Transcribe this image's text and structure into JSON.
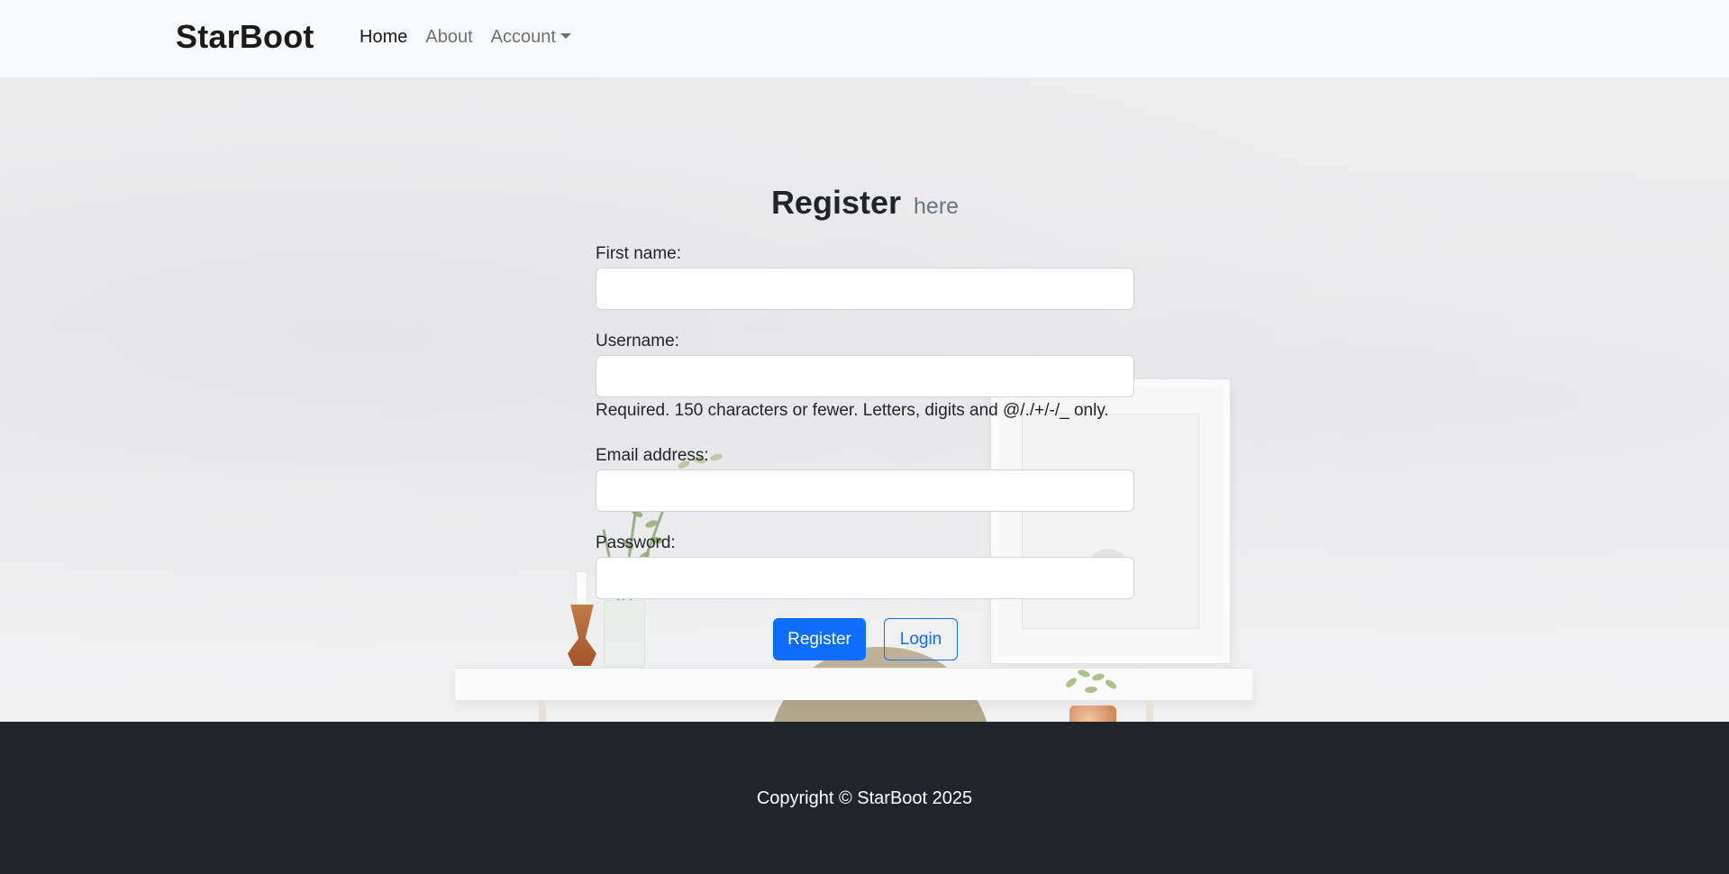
{
  "navbar": {
    "brand": "StarBoot",
    "links": [
      {
        "label": "Home",
        "active": true
      },
      {
        "label": "About",
        "active": false
      },
      {
        "label": "Account",
        "active": false,
        "dropdown": true
      }
    ]
  },
  "form": {
    "title": "Register",
    "title_small": "here",
    "fields": {
      "first_name": {
        "label": "First name:",
        "value": ""
      },
      "username": {
        "label": "Username:",
        "value": "",
        "help": "Required. 150 characters or fewer. Letters, digits and @/./+/-/_ only."
      },
      "email": {
        "label": "Email address:",
        "value": ""
      },
      "password": {
        "label": "Password:",
        "value": ""
      }
    },
    "register_label": "Register",
    "login_label": "Login"
  },
  "footer": {
    "copyright": "Copyright © StarBoot 2025"
  },
  "colors": {
    "primary": "#0d6efd",
    "navbar_bg": "#f8f9fa",
    "footer_bg": "#212529"
  },
  "icons": {
    "account_dropdown": "caret-down-icon"
  }
}
